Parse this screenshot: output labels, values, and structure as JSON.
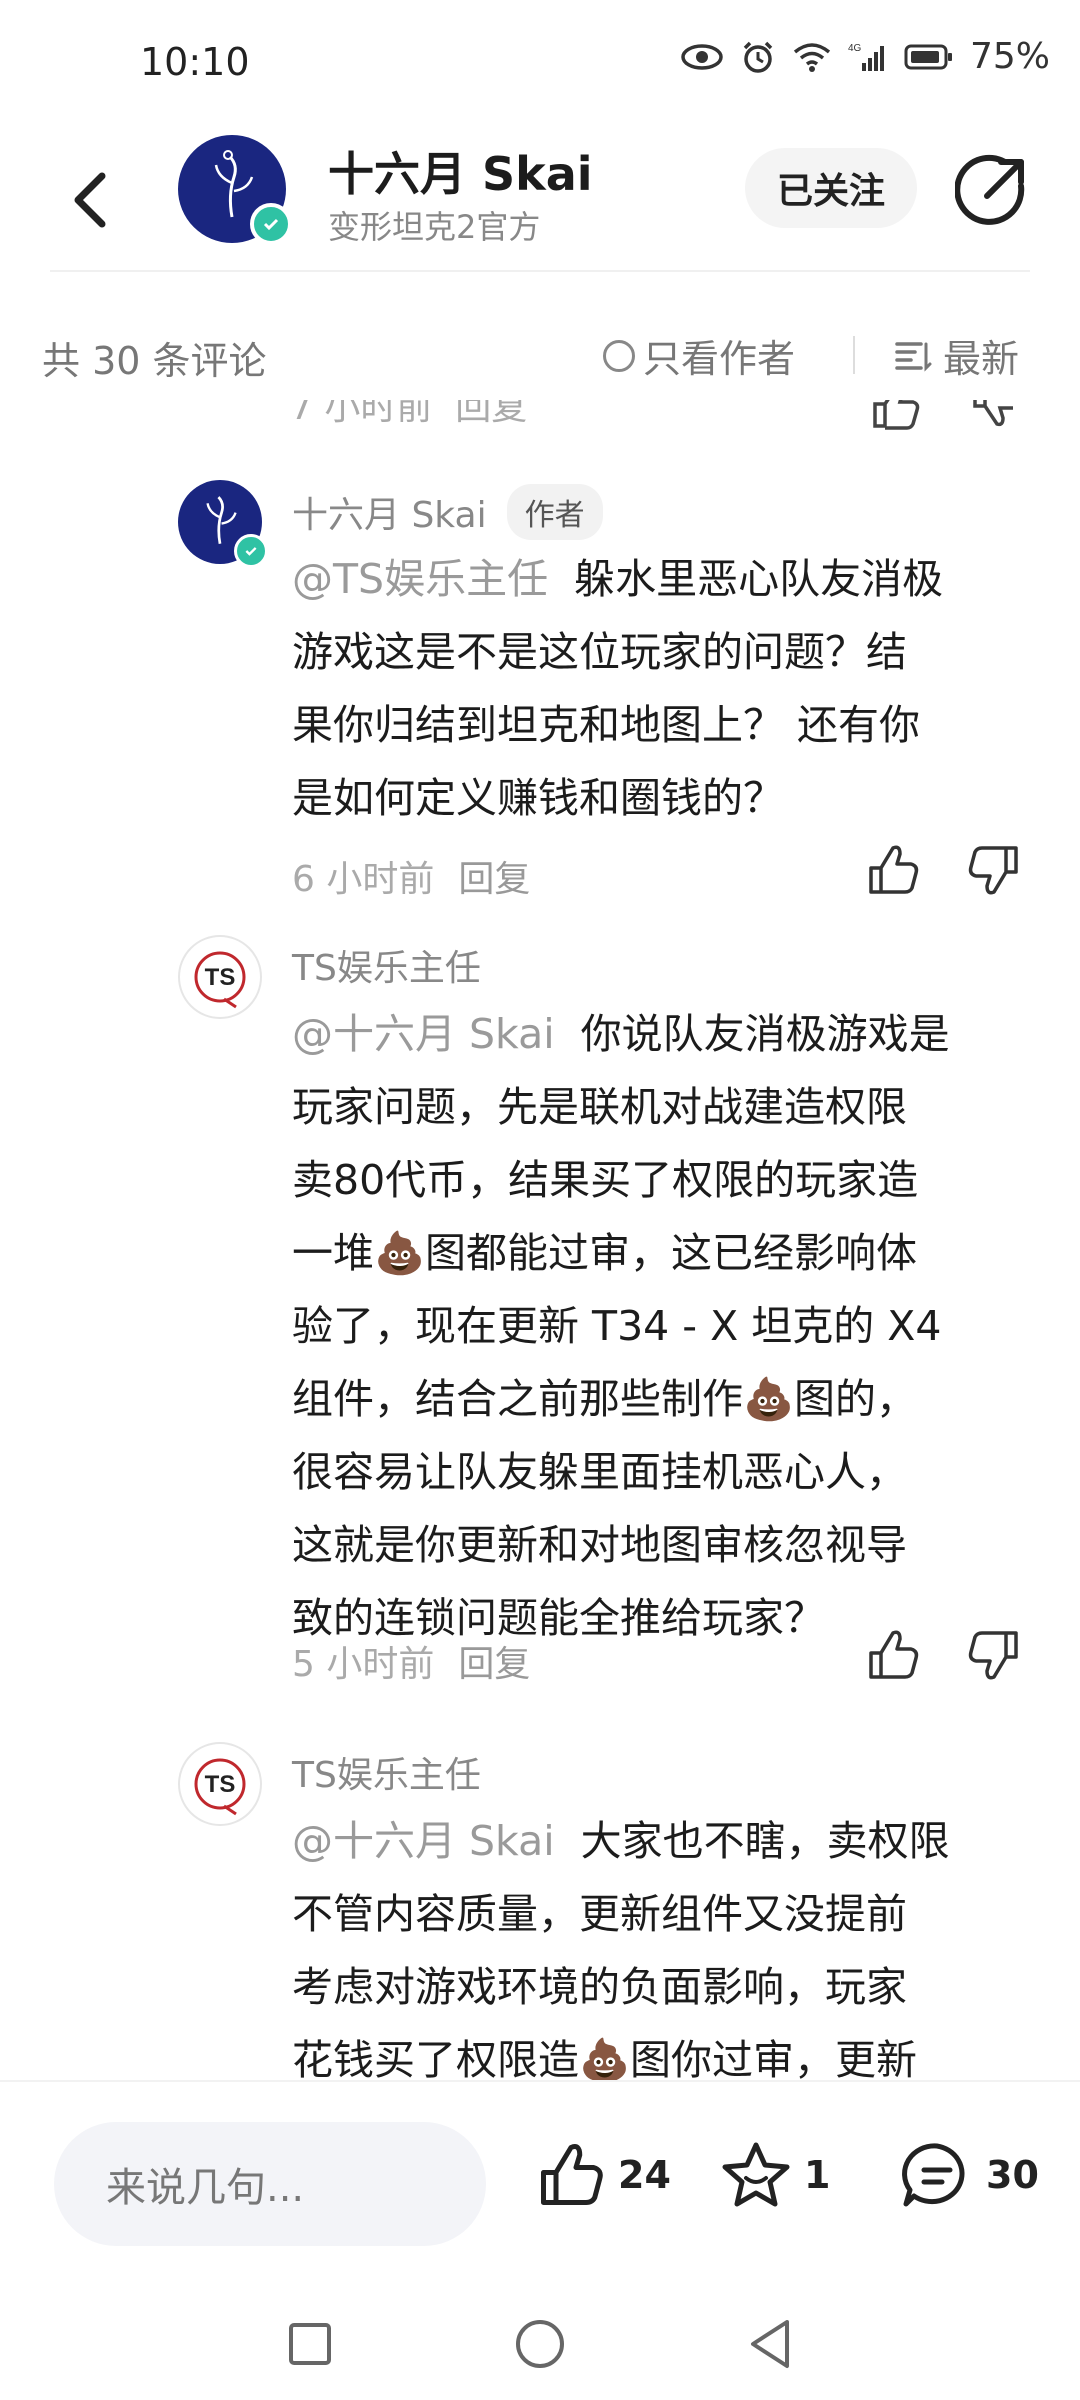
{
  "status_bar": {
    "time": "10:10",
    "battery": "75%"
  },
  "header": {
    "name": "十六月 Skai",
    "subtitle": "变形坦克2官方",
    "follow_label": "已关注"
  },
  "filter": {
    "count_label": "共 30 条评论",
    "author_only_label": "只看作者",
    "sort_label": "最新"
  },
  "comments": [
    {
      "author": "十六月 Skai",
      "tag": "作者",
      "mention": "@TS娱乐主任",
      "lines": [
        "躲水里恶心队友消极",
        "游戏这是不是这位玩家的问题？结",
        "果你归结到坦克和地图上？ 还有你",
        "是如何定义赚钱和圈钱的？"
      ],
      "time": "6 小时前",
      "reply": "回复"
    },
    {
      "author": "TS娱乐主任",
      "mention": "@十六月 Skai",
      "lines": [
        "你说队友消极游戏是",
        "玩家问题，先是联机对战建造权限",
        "卖80代币，结果买了权限的玩家造",
        "一堆💩图都能过审，这已经影响体",
        "验了，现在更新 T34 - X 坦克的 X4",
        "组件，结合之前那些制作💩图的，",
        "很容易让队友躲里面挂机恶心人，",
        "这就是你更新和对地图审核忽视导",
        "致的连锁问题能全推给玩家？"
      ],
      "time": "5 小时前",
      "reply": "回复"
    },
    {
      "author": "TS娱乐主任",
      "mention": "@十六月 Skai",
      "lines": [
        "大家也不瞎，卖权限",
        "不管内容质量，更新组件又没提前",
        "考虑对游戏环境的负面影响，玩家",
        "花钱买了权限造💩图你过审，更新"
      ]
    }
  ],
  "partial_top": {
    "time": "7 小时前",
    "reply": "回复"
  },
  "bottom_bar": {
    "input_placeholder": "来说几句...",
    "likes": "24",
    "favorites": "1",
    "comments": "30"
  },
  "colors": {
    "avatar_blue": "#1a2680",
    "verified_badge": "#2fc2a4",
    "accent_text": "#1c1c1c"
  },
  "icons": [
    "back-arrow-icon",
    "share-icon",
    "thumbs-up-icon",
    "thumbs-down-icon",
    "star-icon",
    "comment-bubble-icon",
    "eye-icon",
    "alarm-icon",
    "wifi-icon",
    "signal-icon",
    "battery-icon",
    "sort-list-icon"
  ]
}
